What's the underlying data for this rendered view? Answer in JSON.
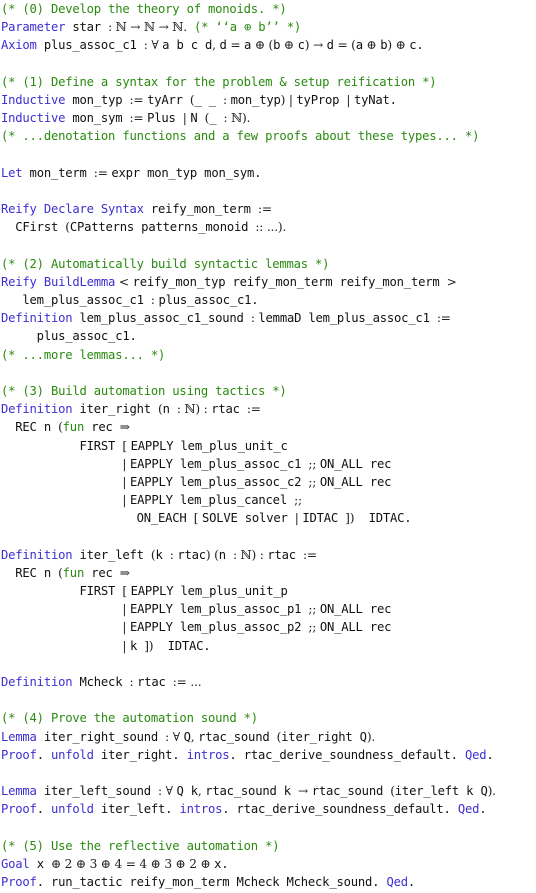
{
  "document": {
    "language": "Coq",
    "lines": [
      {
        "section": "0",
        "tokens": [
          {
            "k": "cm",
            "t": "(* (0) Develop the theory of monoids. *)"
          }
        ]
      },
      {
        "tokens": [
          {
            "k": "kw",
            "t": "Parameter"
          },
          {
            "k": "tx",
            "t": " star "
          },
          {
            "k": "math",
            "t": ": ℕ → ℕ → ℕ."
          },
          {
            "k": "cm",
            "t": " (* ‘‘a ⊕ b’’ *)"
          }
        ]
      },
      {
        "tokens": [
          {
            "k": "kw",
            "t": "Axiom"
          },
          {
            "k": "tx",
            "t": " plus_assoc_c1 "
          },
          {
            "k": "math",
            "t": ": ∀ "
          },
          {
            "k": "tx",
            "t": "a b c d"
          },
          {
            "k": "math",
            "t": ", "
          },
          {
            "k": "tx",
            "t": "d"
          },
          {
            "k": "math",
            "t": " = "
          },
          {
            "k": "tx",
            "t": "a"
          },
          {
            "k": "math",
            "t": " ⊕ ("
          },
          {
            "k": "tx",
            "t": "b"
          },
          {
            "k": "math",
            "t": " ⊕ "
          },
          {
            "k": "tx",
            "t": "c"
          },
          {
            "k": "math",
            "t": ") → "
          },
          {
            "k": "tx",
            "t": "d"
          },
          {
            "k": "math",
            "t": " = ("
          },
          {
            "k": "tx",
            "t": "a"
          },
          {
            "k": "math",
            "t": " ⊕ "
          },
          {
            "k": "tx",
            "t": "b"
          },
          {
            "k": "math",
            "t": ") ⊕ "
          },
          {
            "k": "tx",
            "t": "c."
          }
        ]
      },
      {
        "tokens": []
      },
      {
        "section": "1",
        "tokens": [
          {
            "k": "cm",
            "t": "(* (1) Define a syntax for the problem & setup reification *)"
          }
        ]
      },
      {
        "tokens": [
          {
            "k": "kw",
            "t": "Inductive"
          },
          {
            "k": "tx",
            "t": " mon_typ "
          },
          {
            "k": "math",
            "t": ":= "
          },
          {
            "k": "tx",
            "t": "tyArr "
          },
          {
            "k": "math",
            "t": "("
          },
          {
            "k": "tx",
            "t": "_ _ "
          },
          {
            "k": "math",
            "t": ": "
          },
          {
            "k": "tx",
            "t": "mon_typ"
          },
          {
            "k": "math",
            "t": ") | "
          },
          {
            "k": "tx",
            "t": "tyProp "
          },
          {
            "k": "math",
            "t": "| "
          },
          {
            "k": "tx",
            "t": "tyNat."
          }
        ]
      },
      {
        "tokens": [
          {
            "k": "kw",
            "t": "Inductive"
          },
          {
            "k": "tx",
            "t": " mon_sym "
          },
          {
            "k": "math",
            "t": ":= "
          },
          {
            "k": "tx",
            "t": "Plus "
          },
          {
            "k": "math",
            "t": "| "
          },
          {
            "k": "tx",
            "t": "N "
          },
          {
            "k": "math",
            "t": "("
          },
          {
            "k": "tx",
            "t": "_ "
          },
          {
            "k": "math",
            "t": ": ℕ)."
          }
        ]
      },
      {
        "tokens": [
          {
            "k": "cm",
            "t": "(* ...denotation functions and a few proofs about these types... *)"
          }
        ]
      },
      {
        "tokens": []
      },
      {
        "tokens": [
          {
            "k": "kw",
            "t": "Let"
          },
          {
            "k": "tx",
            "t": " mon_term "
          },
          {
            "k": "math",
            "t": ":= "
          },
          {
            "k": "tx",
            "t": "expr mon_typ mon_sym."
          }
        ]
      },
      {
        "tokens": []
      },
      {
        "tokens": [
          {
            "k": "kw",
            "t": "Reify Declare Syntax"
          },
          {
            "k": "tx",
            "t": " reify_mon_term "
          },
          {
            "k": "math",
            "t": ":="
          }
        ]
      },
      {
        "tokens": [
          {
            "k": "tx",
            "t": "  CFirst "
          },
          {
            "k": "math",
            "t": "("
          },
          {
            "k": "tx",
            "t": "CPatterns patterns_monoid "
          },
          {
            "k": "math",
            "t": ":: ...)."
          }
        ]
      },
      {
        "tokens": []
      },
      {
        "section": "2",
        "tokens": [
          {
            "k": "cm",
            "t": "(* (2) Automatically build syntactic lemmas *)"
          }
        ]
      },
      {
        "tokens": [
          {
            "k": "kw",
            "t": "Reify BuildLemma"
          },
          {
            "k": "math",
            "t": " < "
          },
          {
            "k": "tx",
            "t": "reify_mon_typ reify_mon_term reify_mon_term "
          },
          {
            "k": "math",
            "t": ">"
          }
        ]
      },
      {
        "tokens": [
          {
            "k": "tx",
            "t": "   lem_plus_assoc_c1 "
          },
          {
            "k": "math",
            "t": ": "
          },
          {
            "k": "tx",
            "t": "plus_assoc_c1."
          }
        ]
      },
      {
        "tokens": [
          {
            "k": "kw",
            "t": "Definition"
          },
          {
            "k": "tx",
            "t": " lem_plus_assoc_c1_sound "
          },
          {
            "k": "math",
            "t": ": "
          },
          {
            "k": "tx",
            "t": "lemmaD lem_plus_assoc_c1 "
          },
          {
            "k": "math",
            "t": ":="
          }
        ]
      },
      {
        "tokens": [
          {
            "k": "tx",
            "t": "     plus_assoc_c1."
          }
        ]
      },
      {
        "tokens": [
          {
            "k": "cm",
            "t": "(* ...more lemmas... *)"
          }
        ]
      },
      {
        "tokens": []
      },
      {
        "section": "3",
        "tokens": [
          {
            "k": "cm",
            "t": "(* (3) Build automation using tactics *)"
          }
        ]
      },
      {
        "tokens": [
          {
            "k": "kw",
            "t": "Definition"
          },
          {
            "k": "tx",
            "t": " iter_right "
          },
          {
            "k": "math",
            "t": "("
          },
          {
            "k": "tx",
            "t": "n "
          },
          {
            "k": "math",
            "t": ": ℕ) : "
          },
          {
            "k": "tx",
            "t": "rtac "
          },
          {
            "k": "math",
            "t": ":="
          }
        ]
      },
      {
        "tokens": [
          {
            "k": "tx",
            "t": "  REC n "
          },
          {
            "k": "math",
            "t": "("
          },
          {
            "k": "gk",
            "t": "fun"
          },
          {
            "k": "tx",
            "t": " rec "
          },
          {
            "k": "math",
            "t": "⇒"
          }
        ]
      },
      {
        "tokens": [
          {
            "k": "tx",
            "t": "           FIRST "
          },
          {
            "k": "math",
            "t": "[ "
          },
          {
            "k": "tx",
            "t": "EAPPLY lem_plus_unit_c"
          }
        ]
      },
      {
        "tokens": [
          {
            "k": "tx",
            "t": "                 "
          },
          {
            "k": "math",
            "t": "| "
          },
          {
            "k": "tx",
            "t": "EAPPLY lem_plus_assoc_c1 "
          },
          {
            "k": "math",
            "t": ";; "
          },
          {
            "k": "tx",
            "t": "ON_ALL rec"
          }
        ]
      },
      {
        "tokens": [
          {
            "k": "tx",
            "t": "                 "
          },
          {
            "k": "math",
            "t": "| "
          },
          {
            "k": "tx",
            "t": "EAPPLY lem_plus_assoc_c2 "
          },
          {
            "k": "math",
            "t": ";; "
          },
          {
            "k": "tx",
            "t": "ON_ALL rec"
          }
        ]
      },
      {
        "tokens": [
          {
            "k": "tx",
            "t": "                 "
          },
          {
            "k": "math",
            "t": "| "
          },
          {
            "k": "tx",
            "t": "EAPPLY lem_plus_cancel "
          },
          {
            "k": "math",
            "t": ";;"
          }
        ]
      },
      {
        "tokens": [
          {
            "k": "tx",
            "t": "                   ON_EACH "
          },
          {
            "k": "math",
            "t": "[ "
          },
          {
            "k": "tx",
            "t": "SOLVE solver "
          },
          {
            "k": "math",
            "t": "| "
          },
          {
            "k": "tx",
            "t": "IDTAC "
          },
          {
            "k": "math",
            "t": "])"
          },
          {
            "k": "tx",
            "t": "  IDTAC."
          }
        ]
      },
      {
        "tokens": []
      },
      {
        "tokens": [
          {
            "k": "kw",
            "t": "Definition"
          },
          {
            "k": "tx",
            "t": " iter_left "
          },
          {
            "k": "math",
            "t": "("
          },
          {
            "k": "tx",
            "t": "k "
          },
          {
            "k": "math",
            "t": ": "
          },
          {
            "k": "tx",
            "t": "rtac"
          },
          {
            "k": "math",
            "t": ") ("
          },
          {
            "k": "tx",
            "t": "n "
          },
          {
            "k": "math",
            "t": ": ℕ) : "
          },
          {
            "k": "tx",
            "t": "rtac "
          },
          {
            "k": "math",
            "t": ":="
          }
        ]
      },
      {
        "tokens": [
          {
            "k": "tx",
            "t": "  REC n "
          },
          {
            "k": "math",
            "t": "("
          },
          {
            "k": "gk",
            "t": "fun"
          },
          {
            "k": "tx",
            "t": " rec "
          },
          {
            "k": "math",
            "t": "⇒"
          }
        ]
      },
      {
        "tokens": [
          {
            "k": "tx",
            "t": "           FIRST "
          },
          {
            "k": "math",
            "t": "[ "
          },
          {
            "k": "tx",
            "t": "EAPPLY lem_plus_unit_p"
          }
        ]
      },
      {
        "tokens": [
          {
            "k": "tx",
            "t": "                 "
          },
          {
            "k": "math",
            "t": "| "
          },
          {
            "k": "tx",
            "t": "EAPPLY lem_plus_assoc_p1 "
          },
          {
            "k": "math",
            "t": ";; "
          },
          {
            "k": "tx",
            "t": "ON_ALL rec"
          }
        ]
      },
      {
        "tokens": [
          {
            "k": "tx",
            "t": "                 "
          },
          {
            "k": "math",
            "t": "| "
          },
          {
            "k": "tx",
            "t": "EAPPLY lem_plus_assoc_p2 "
          },
          {
            "k": "math",
            "t": ";; "
          },
          {
            "k": "tx",
            "t": "ON_ALL rec"
          }
        ]
      },
      {
        "tokens": [
          {
            "k": "tx",
            "t": "                 "
          },
          {
            "k": "math",
            "t": "| "
          },
          {
            "k": "tx",
            "t": "k "
          },
          {
            "k": "math",
            "t": "])"
          },
          {
            "k": "tx",
            "t": "  IDTAC."
          }
        ]
      },
      {
        "tokens": []
      },
      {
        "tokens": [
          {
            "k": "kw",
            "t": "Definition"
          },
          {
            "k": "tx",
            "t": " Mcheck "
          },
          {
            "k": "math",
            "t": ": "
          },
          {
            "k": "tx",
            "t": "rtac "
          },
          {
            "k": "math",
            "t": ":= ..."
          }
        ]
      },
      {
        "tokens": []
      },
      {
        "section": "4",
        "tokens": [
          {
            "k": "cm",
            "t": "(* (4) Prove the automation sound *)"
          }
        ]
      },
      {
        "tokens": [
          {
            "k": "kw",
            "t": "Lemma"
          },
          {
            "k": "tx",
            "t": " iter_right_sound "
          },
          {
            "k": "math",
            "t": ": ∀ "
          },
          {
            "k": "tx",
            "t": "Q"
          },
          {
            "k": "math",
            "t": ", "
          },
          {
            "k": "tx",
            "t": "rtac_sound "
          },
          {
            "k": "math",
            "t": "("
          },
          {
            "k": "tx",
            "t": "iter_right Q"
          },
          {
            "k": "math",
            "t": ")."
          }
        ]
      },
      {
        "tokens": [
          {
            "k": "kw",
            "t": "Proof"
          },
          {
            "k": "tx",
            "t": ". "
          },
          {
            "k": "kw",
            "t": "unfold"
          },
          {
            "k": "tx",
            "t": " iter_right. "
          },
          {
            "k": "kw",
            "t": "intros"
          },
          {
            "k": "tx",
            "t": ". rtac_derive_soundness_default. "
          },
          {
            "k": "kw",
            "t": "Qed"
          },
          {
            "k": "tx",
            "t": "."
          }
        ]
      },
      {
        "tokens": []
      },
      {
        "tokens": [
          {
            "k": "kw",
            "t": "Lemma"
          },
          {
            "k": "tx",
            "t": " iter_left_sound "
          },
          {
            "k": "math",
            "t": ": ∀ "
          },
          {
            "k": "tx",
            "t": "Q k"
          },
          {
            "k": "math",
            "t": ", "
          },
          {
            "k": "tx",
            "t": "rtac_sound k "
          },
          {
            "k": "math",
            "t": "→ "
          },
          {
            "k": "tx",
            "t": "rtac_sound "
          },
          {
            "k": "math",
            "t": "("
          },
          {
            "k": "tx",
            "t": "iter_left k Q"
          },
          {
            "k": "math",
            "t": ")."
          }
        ]
      },
      {
        "tokens": [
          {
            "k": "kw",
            "t": "Proof"
          },
          {
            "k": "tx",
            "t": ". "
          },
          {
            "k": "kw",
            "t": "unfold"
          },
          {
            "k": "tx",
            "t": " iter_left. "
          },
          {
            "k": "kw",
            "t": "intros"
          },
          {
            "k": "tx",
            "t": ". rtac_derive_soundness_default. "
          },
          {
            "k": "kw",
            "t": "Qed"
          },
          {
            "k": "tx",
            "t": "."
          }
        ]
      },
      {
        "tokens": []
      },
      {
        "section": "5",
        "tokens": [
          {
            "k": "cm",
            "t": "(* (5) Use the reflective automation *)"
          }
        ]
      },
      {
        "tokens": [
          {
            "k": "kw",
            "t": "Goal"
          },
          {
            "k": "tx",
            "t": " x "
          },
          {
            "k": "math",
            "t": "⊕ 2 ⊕ 3 ⊕ 4 = 4 ⊕ 3 ⊕ 2 ⊕ "
          },
          {
            "k": "tx",
            "t": "x."
          }
        ]
      },
      {
        "tokens": [
          {
            "k": "kw",
            "t": "Proof"
          },
          {
            "k": "tx",
            "t": ". run_tactic reify_mon_term Mcheck Mcheck_sound. "
          },
          {
            "k": "kw",
            "t": "Qed"
          },
          {
            "k": "tx",
            "t": "."
          }
        ]
      }
    ]
  }
}
